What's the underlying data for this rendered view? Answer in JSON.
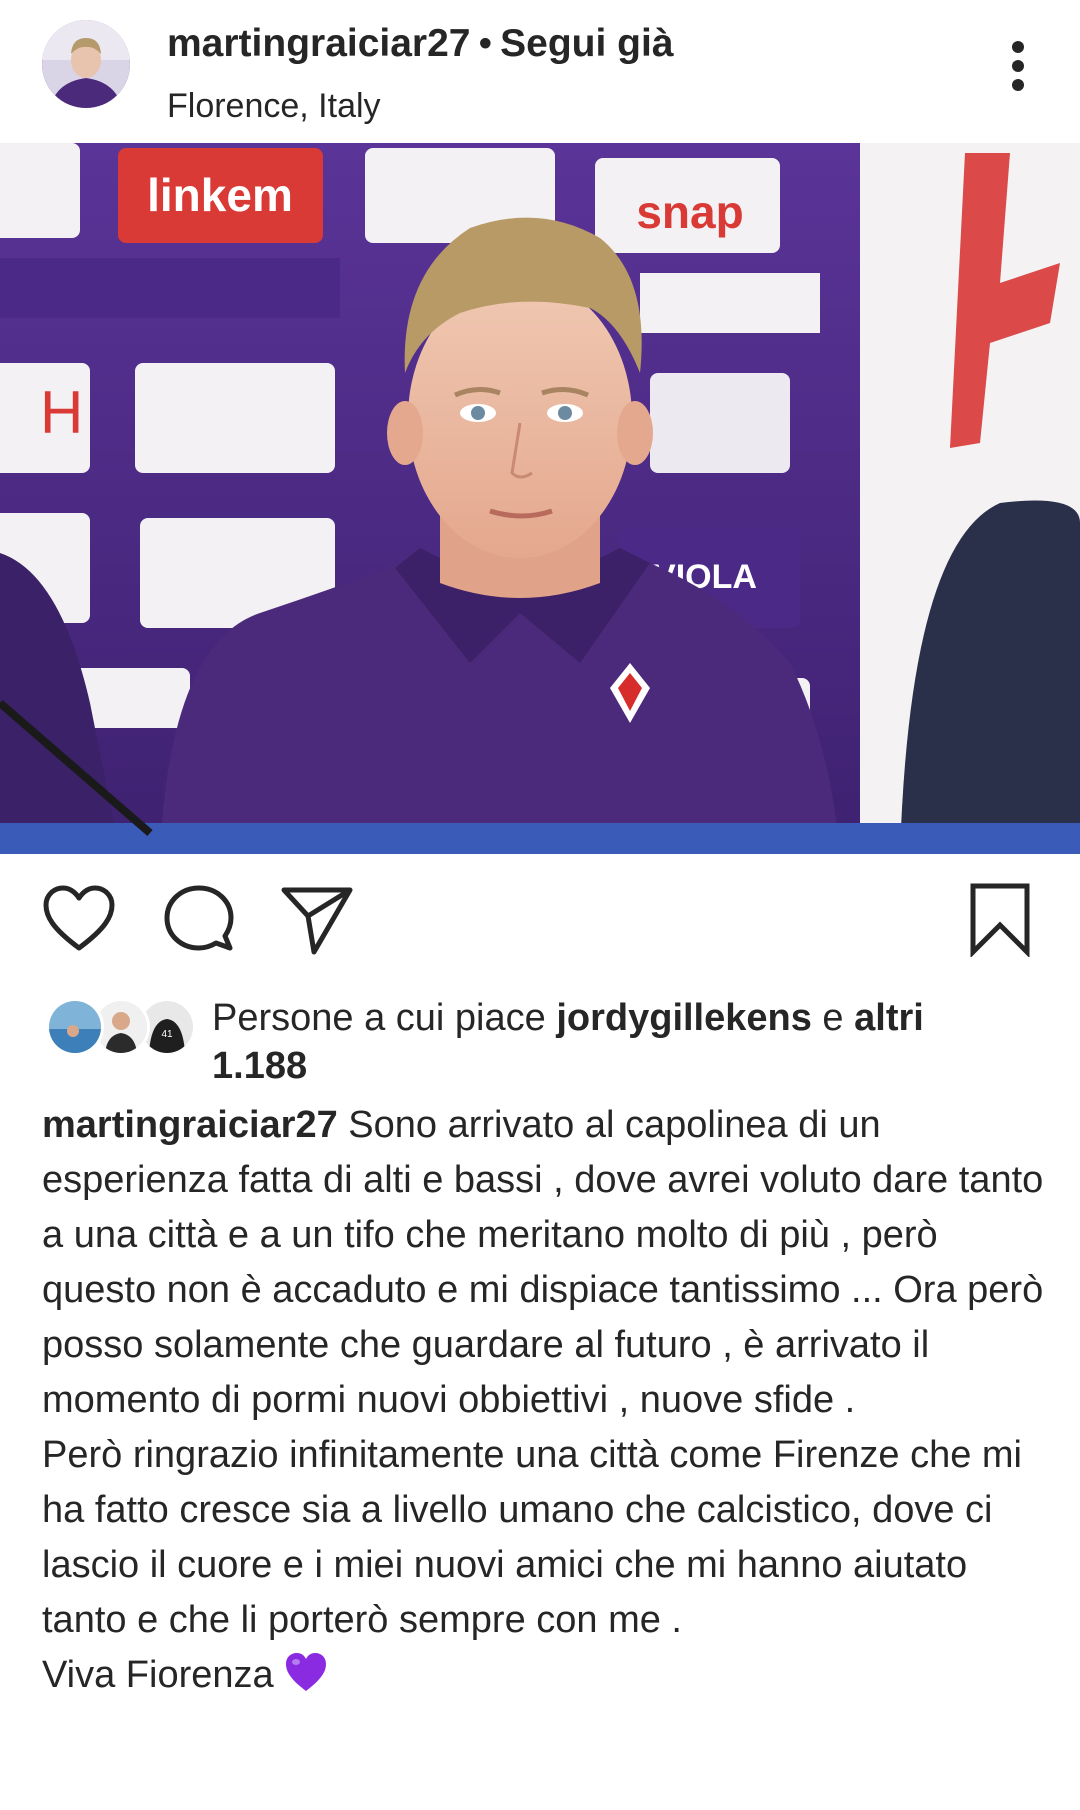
{
  "header": {
    "username": "martingraiciar27",
    "separator": "•",
    "follow_status": "Segui già",
    "location": "Florence, Italy"
  },
  "post": {
    "image_description_icon": "photo-press-conference"
  },
  "actions": {
    "like_icon": "heart-outline-icon",
    "comment_icon": "comment-bubble-icon",
    "share_icon": "paper-plane-icon",
    "save_icon": "bookmark-outline-icon"
  },
  "likes": {
    "prefix": "Persone a cui piace ",
    "user": "jordygillekens",
    "middle": " e ",
    "others_label": "altri",
    "count": "1.188"
  },
  "caption": {
    "username": "martingraiciar27",
    "first_paragraph": "Sono arrivato al capolinea di un esperienza fatta di alti e bassi , dove avrei voluto dare tanto a una città e a un tifo che meritano molto di più , però questo non è accaduto e mi dispiace tantissimo ... Ora però posso solamente che guardare al futuro , è arrivato il momento  di pormi nuovi obbiettivi ,  nuove sfide .",
    "second_paragraph": "Però ringrazio infinitamente una città come Firenze che mi ha fatto cresce sia a livello umano che calcistico, dove ci lascio il cuore e i miei nuovi amici che mi hanno aiutato tanto e che li porterò sempre con me .",
    "closing": "Viva Fiorenza",
    "closing_emoji": "purple-heart-icon"
  },
  "colors": {
    "text": "#262626",
    "fiorentina_purple": "#4b2a7b",
    "purple_heart": "#8a2be2"
  }
}
